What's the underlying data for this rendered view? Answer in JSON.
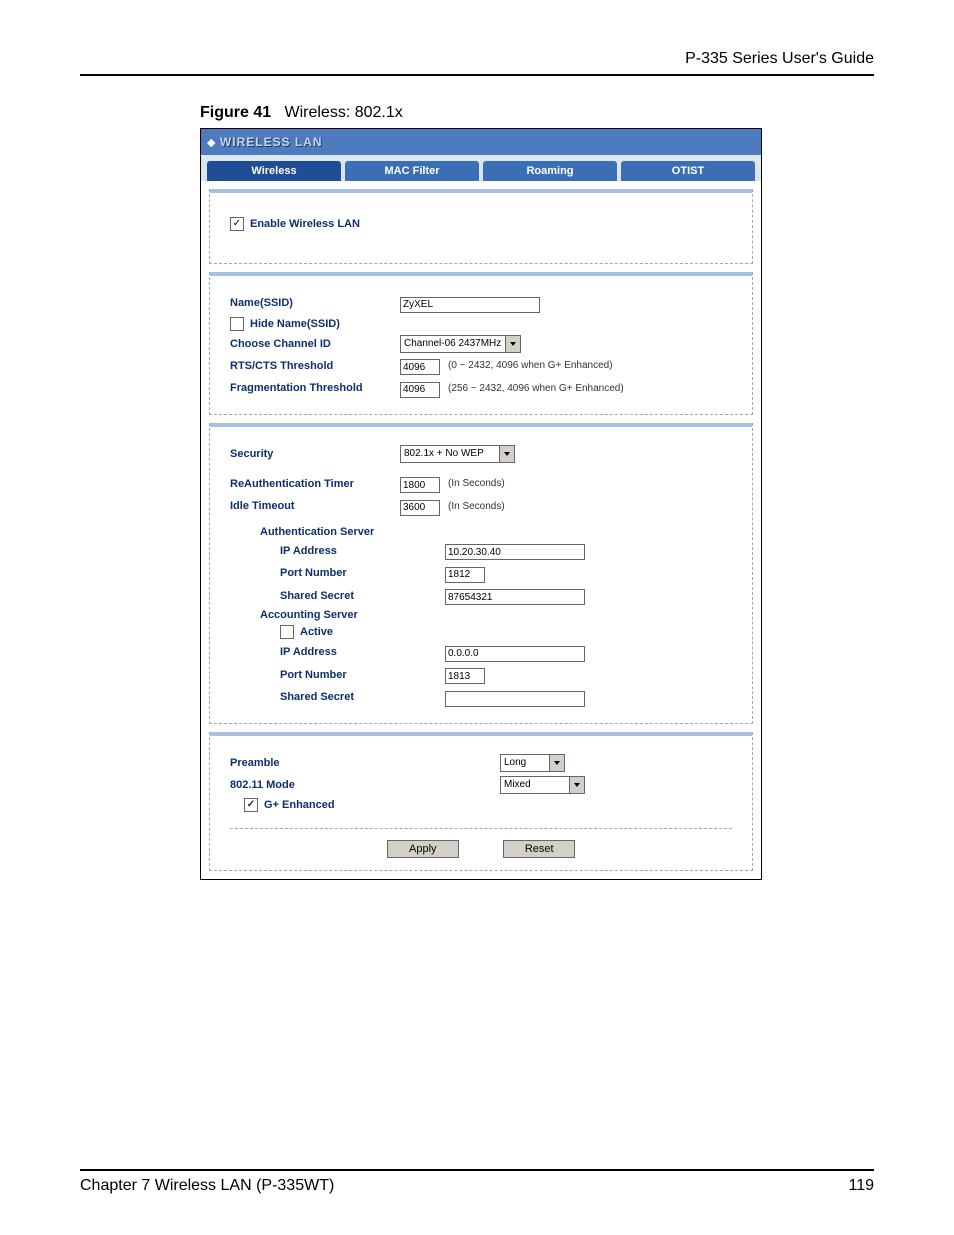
{
  "doc": {
    "running_header": "P-335 Series User's Guide",
    "figure_label": "Figure 41",
    "figure_title": "Wireless: 802.1x",
    "chapter": "Chapter 7 Wireless LAN (P-335WT)",
    "page_number": "119"
  },
  "panel": {
    "title": "WIRELESS LAN",
    "tabs": [
      "Wireless",
      "MAC Filter",
      "Roaming",
      "OTIST"
    ]
  },
  "enable_wlan": {
    "label": "Enable Wireless LAN",
    "checked": "✓"
  },
  "basic": {
    "name_ssid_label": "Name(SSID)",
    "name_ssid_value": "ZyXEL",
    "hide_label": "Hide Name(SSID)",
    "hide_checked": "",
    "channel_label": "Choose Channel ID",
    "channel_value": "Channel-06 2437MHz",
    "rts_label": "RTS/CTS Threshold",
    "rts_value": "4096",
    "rts_hint": "(0 ~ 2432, 4096 when G+ Enhanced)",
    "frag_label": "Fragmentation  Threshold",
    "frag_value": "4096",
    "frag_hint": "(256 ~ 2432, 4096 when G+ Enhanced)"
  },
  "security": {
    "security_label": "Security",
    "security_value": "802.1x + No WEP",
    "reauth_label": "ReAuthentication Timer",
    "reauth_value": "1800",
    "reauth_hint": "(In Seconds)",
    "idle_label": "Idle Timeout",
    "idle_value": "3600",
    "idle_hint": "(In Seconds)",
    "auth_header": "Authentication Server",
    "auth_ip_label": "IP Address",
    "auth_ip_value": "10.20.30.40",
    "auth_port_label": "Port Number",
    "auth_port_value": "1812",
    "auth_secret_label": "Shared Secret",
    "auth_secret_value": "87654321",
    "acct_header": "Accounting Server",
    "acct_active_label": "Active",
    "acct_active_checked": "",
    "acct_ip_label": "IP Address",
    "acct_ip_value": "0.0.0.0",
    "acct_port_label": "Port Number",
    "acct_port_value": "1813",
    "acct_secret_label": "Shared Secret",
    "acct_secret_value": ""
  },
  "advanced": {
    "preamble_label": "Preamble",
    "preamble_value": "Long",
    "mode_label": "802.11 Mode",
    "mode_value": "Mixed",
    "gplus_label": "G+ Enhanced",
    "gplus_checked": "✓"
  },
  "buttons": {
    "apply": "Apply",
    "reset": "Reset"
  }
}
